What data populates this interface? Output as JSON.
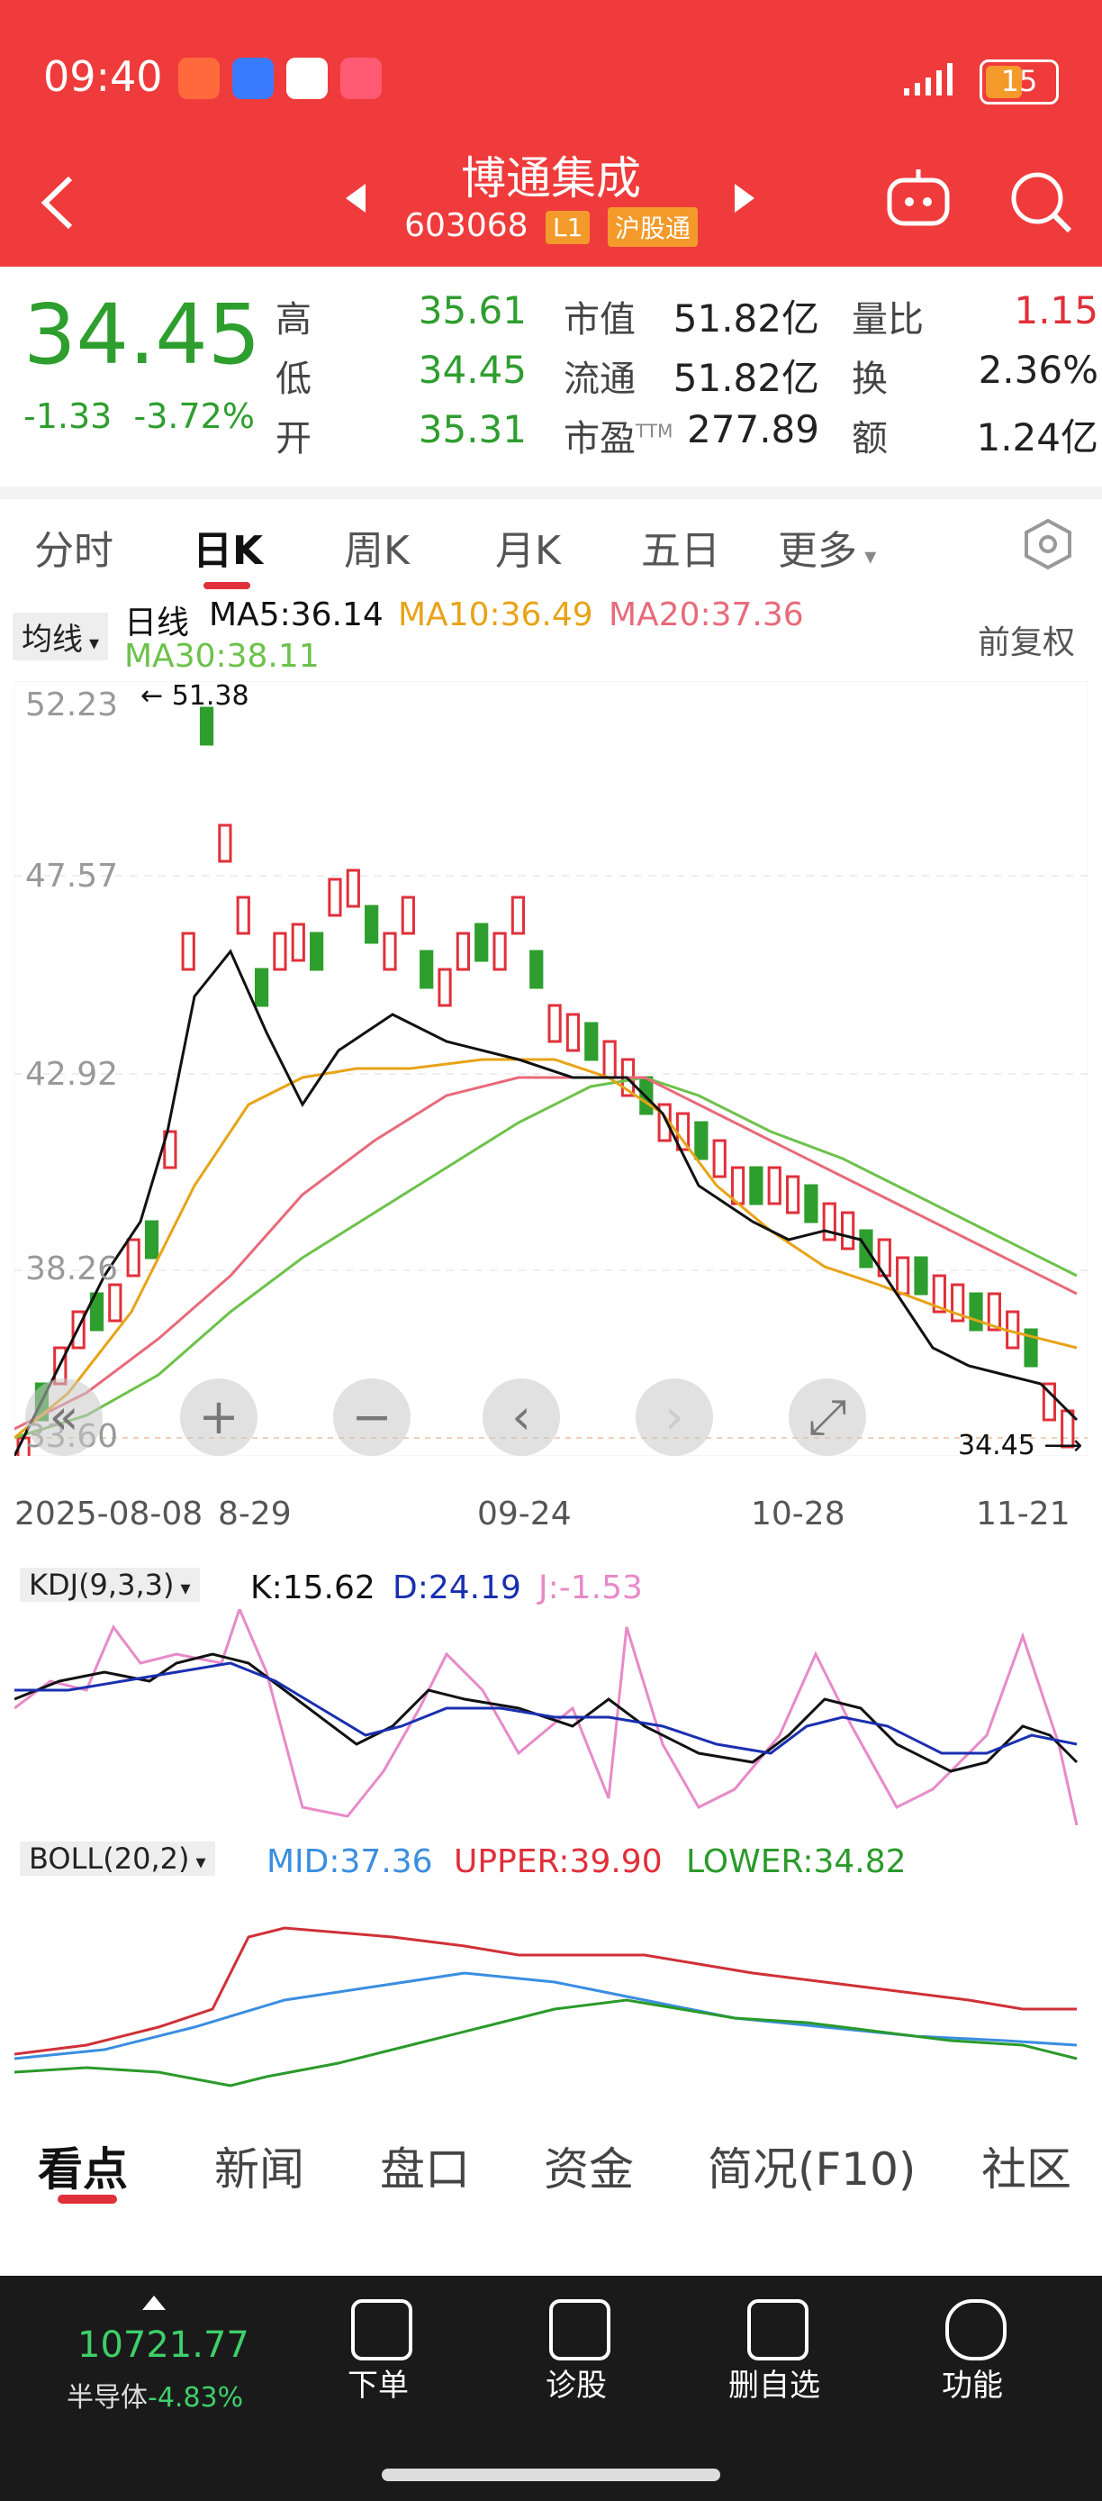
{
  "status": {
    "time": "09:40",
    "battery": "15"
  },
  "header": {
    "name": "博通集成",
    "code": "603068",
    "level_tag": "L1",
    "market_tag": "沪股通"
  },
  "quote": {
    "price": "34.45",
    "change": "-1.33",
    "change_pct": "-3.72%",
    "high_label": "高",
    "high": "35.61",
    "low_label": "低",
    "low": "34.45",
    "open_label": "开",
    "open": "35.31",
    "mktcap_label": "市值",
    "mktcap": "51.82亿",
    "float_label": "流通",
    "float": "51.82亿",
    "pe_label": "市盈",
    "pe_sup": "TTM",
    "pe": "277.89",
    "vr_label": "量比",
    "vr": "1.15",
    "turnover_label": "换",
    "turnover": "2.36%",
    "amount_label": "额",
    "amount": "1.24亿"
  },
  "tabs": [
    "分时",
    "日K",
    "周K",
    "月K",
    "五日",
    "更多"
  ],
  "active_tab": "日K",
  "ma_bar": {
    "selector": "均线",
    "prefix": "日线",
    "ma5": "MA5:36.14",
    "ma10": "MA10:36.49",
    "ma20": "MA20:37.36",
    "ma30": "MA30:38.11",
    "adjust": "前复权"
  },
  "kline_axis": {
    "y_labels": [
      "52.23",
      "47.57",
      "42.92",
      "38.26",
      "33.60"
    ],
    "high_mark": "51.38",
    "last_mark": "34.45"
  },
  "x_axis": [
    "2025-08-08",
    "8-29",
    "09-24",
    "10-28",
    "11-21"
  ],
  "kdj": {
    "selector": "KDJ(9,3,3)",
    "k": "K:15.62",
    "d": "D:24.19",
    "j": "J:-1.53"
  },
  "boll": {
    "selector": "BOLL(20,2)",
    "mid": "MID:37.36",
    "upper": "UPPER:39.90",
    "lower": "LOWER:34.82"
  },
  "bottom_tabs": [
    "看点",
    "新闻",
    "盘口",
    "资金",
    "简况(F10)",
    "社区"
  ],
  "index_ticker": {
    "value": "10721.77",
    "name": "半导体",
    "pct": "-4.83%"
  },
  "bottom_nav": [
    "下单",
    "诊股",
    "删自选",
    "功能"
  ],
  "colors": {
    "up": "#e0303a",
    "down": "#2e9e2e",
    "ma5": "#111111",
    "ma10": "#e8a317",
    "ma20": "#e86a7a",
    "ma30": "#6cc24a",
    "header": "#ef3b3b"
  }
}
